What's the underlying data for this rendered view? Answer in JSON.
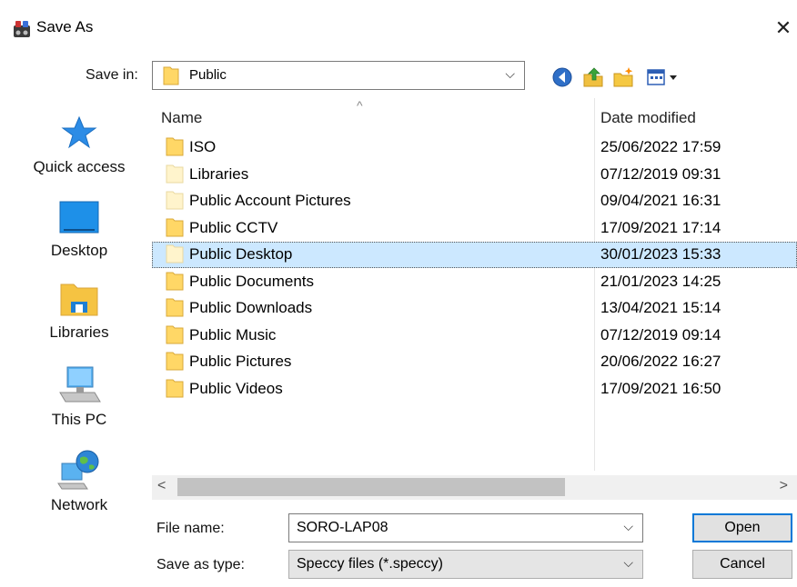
{
  "window": {
    "title": "Save As",
    "close_glyph": "✕"
  },
  "save_in": {
    "label": "Save in:",
    "value": "Public",
    "arrow": "⌵"
  },
  "toolbar": {
    "icons": [
      "back-icon",
      "up-folder-icon",
      "new-folder-icon",
      "view-menu-icon"
    ]
  },
  "places": [
    {
      "label": "Quick access",
      "icon": "star-icon"
    },
    {
      "label": "Desktop",
      "icon": "desktop-icon"
    },
    {
      "label": "Libraries",
      "icon": "libraries-icon"
    },
    {
      "label": "This PC",
      "icon": "computer-icon"
    },
    {
      "label": "Network",
      "icon": "globe-network-icon"
    }
  ],
  "file_list": {
    "columns": {
      "name": "Name",
      "date_modified": "Date modified"
    },
    "sort_caret": "^",
    "rows": [
      {
        "name": "ISO",
        "date": "25/06/2022 17:59",
        "icon": "folder-icon"
      },
      {
        "name": "Libraries",
        "date": "07/12/2019 09:31",
        "icon": "folder-light-icon"
      },
      {
        "name": "Public Account Pictures",
        "date": "09/04/2021 16:31",
        "icon": "folder-light-icon"
      },
      {
        "name": "Public CCTV",
        "date": "17/09/2021 17:14",
        "icon": "folder-icon"
      },
      {
        "name": "Public Desktop",
        "date": "30/01/2023 15:33",
        "icon": "folder-light-icon",
        "selected": true
      },
      {
        "name": "Public Documents",
        "date": "21/01/2023 14:25",
        "icon": "folder-icon"
      },
      {
        "name": "Public Downloads",
        "date": "13/04/2021 15:14",
        "icon": "folder-icon"
      },
      {
        "name": "Public Music",
        "date": "07/12/2019 09:14",
        "icon": "folder-icon"
      },
      {
        "name": "Public Pictures",
        "date": "20/06/2022 16:27",
        "icon": "folder-icon"
      },
      {
        "name": "Public Videos",
        "date": "17/09/2021 16:50",
        "icon": "folder-icon"
      }
    ]
  },
  "scrollbar": {
    "left": "<",
    "right": ">"
  },
  "file_name": {
    "label": "File name:",
    "value": "SORO-LAP08",
    "arrow": "⌵"
  },
  "save_type": {
    "label": "Save as type:",
    "value": "Speccy files (*.speccy)",
    "arrow": "⌵"
  },
  "buttons": {
    "open": "Open",
    "cancel": "Cancel"
  },
  "colors": {
    "selection": "#cce8ff",
    "accent": "#0078d7",
    "folder": "#ffd766"
  }
}
